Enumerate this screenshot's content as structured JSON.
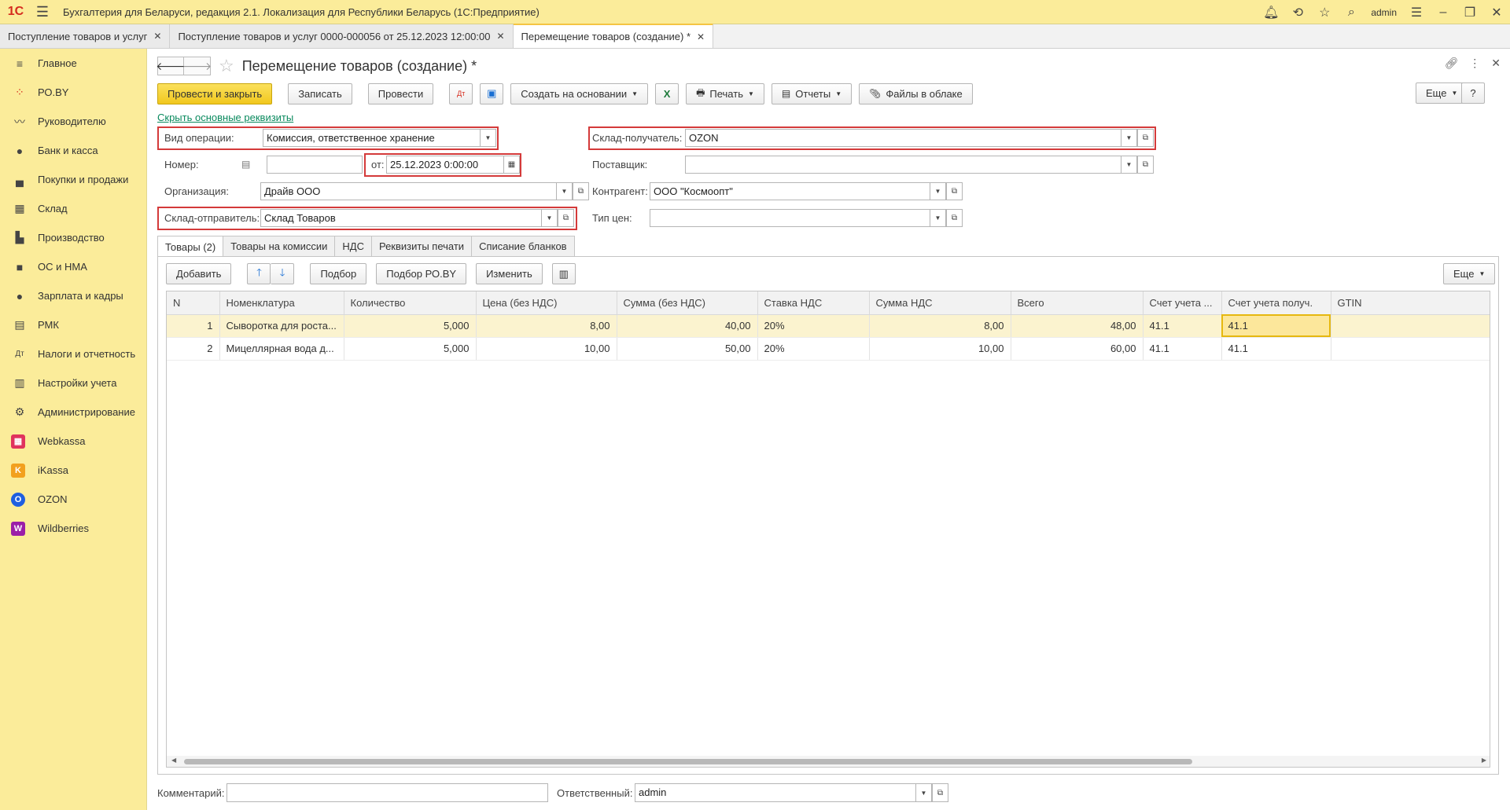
{
  "app": {
    "logo": "1С",
    "title": "Бухгалтерия для Беларуси, редакция 2.1. Локализация для Республики Беларусь   (1С:Предприятие)",
    "user": "admin"
  },
  "open_tabs": [
    {
      "label": "Поступление товаров и услуг"
    },
    {
      "label": "Поступление товаров и услуг 0000-000056 от 25.12.2023 12:00:00"
    },
    {
      "label": "Перемещение товаров (создание) *"
    }
  ],
  "sidebar": {
    "items": [
      {
        "label": "Главное",
        "icon": "≡"
      },
      {
        "label": "РО.BY",
        "icon": "⁘"
      },
      {
        "label": "Руководителю",
        "icon": "〰"
      },
      {
        "label": "Банк и касса",
        "icon": "●"
      },
      {
        "label": "Покупки и продажи",
        "icon": "▄"
      },
      {
        "label": "Склад",
        "icon": "▦"
      },
      {
        "label": "Производство",
        "icon": "▙"
      },
      {
        "label": "ОС и НМА",
        "icon": "■"
      },
      {
        "label": "Зарплата и кадры",
        "icon": "●"
      },
      {
        "label": "РМК",
        "icon": "▤"
      },
      {
        "label": "Налоги и отчетность",
        "icon": "Дт"
      },
      {
        "label": "Настройки учета",
        "icon": "▥"
      },
      {
        "label": "Администрирование",
        "icon": "⚙"
      },
      {
        "label": "Webkassa",
        "icon": "▦"
      },
      {
        "label": "iKassa",
        "icon": "K"
      },
      {
        "label": "OZON",
        "icon": "O"
      },
      {
        "label": "Wildberries",
        "icon": "W"
      }
    ]
  },
  "doc": {
    "title": "Перемещение товаров (создание) *"
  },
  "toolbar": {
    "post_close": "Провести и закрыть",
    "save": "Записать",
    "post": "Провести",
    "create_based": "Создать на основании",
    "print": "Печать",
    "reports": "Отчеты",
    "cloud_files": "Файлы в облаке",
    "more": "Еще",
    "help": "?"
  },
  "hide_link": "Скрыть основные реквизиты",
  "form": {
    "op_type_label": "Вид операции:",
    "op_type_value": "Комиссия, ответственное хранение",
    "number_label": "Номер:",
    "number_value": "",
    "date_label": "от:",
    "date_value": "25.12.2023  0:00:00",
    "org_label": "Организация:",
    "org_value": "Драйв ООО",
    "sender_label": "Склад-отправитель:",
    "sender_value": "Склад Товаров",
    "receiver_label": "Склад-получатель:",
    "receiver_value": "OZON",
    "supplier_label": "Поставщик:",
    "supplier_value": "",
    "counterparty_label": "Контрагент:",
    "counterparty_value": "ООО \"Космоопт\"",
    "price_type_label": "Тип цен:",
    "price_type_value": ""
  },
  "inner_tabs": [
    "Товары (2)",
    "Товары на комиссии",
    "НДС",
    "Реквизиты печати",
    "Списание бланков"
  ],
  "table_toolbar": {
    "add": "Добавить",
    "pick": "Подбор",
    "pick_ro": "Подбор РО.BY",
    "change": "Изменить",
    "more": "Еще"
  },
  "table": {
    "columns": [
      "N",
      "Номенклатура",
      "Количество",
      "Цена (без НДС)",
      "Сумма (без НДС)",
      "Ставка НДС",
      "Сумма НДС",
      "Всего",
      "Счет учета ...",
      "Счет учета получ.",
      "GTIN"
    ],
    "rows": [
      [
        "1",
        "Сыворотка для роста...",
        "5,000",
        "8,00",
        "40,00",
        "20%",
        "8,00",
        "48,00",
        "41.1",
        "41.1",
        ""
      ],
      [
        "2",
        "Мицеллярная вода д...",
        "5,000",
        "10,00",
        "50,00",
        "20%",
        "10,00",
        "60,00",
        "41.1",
        "41.1",
        ""
      ]
    ]
  },
  "footer": {
    "comment_label": "Комментарий:",
    "comment_value": "",
    "responsible_label": "Ответственный:",
    "responsible_value": "admin"
  },
  "colors": {
    "sidebar_bg": "#FBEC9A",
    "primary_btn": "#F1C81E",
    "highlight_border": "#D43A3A",
    "link": "#0A8A5E"
  }
}
